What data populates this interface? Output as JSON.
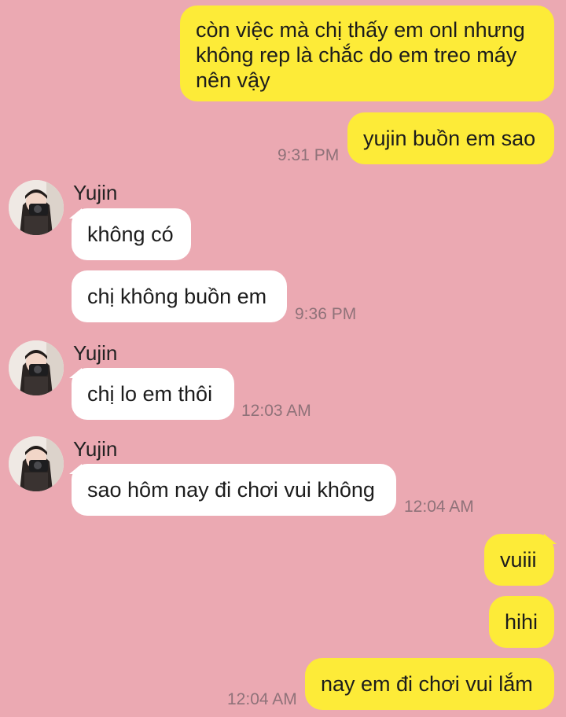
{
  "messages": {
    "m1": "còn việc mà chị thấy em onl nhưng không rep là chắc do em treo máy nên vậy",
    "m2": "yujin buồn em sao",
    "t2": "9:31 PM",
    "m3": "không có",
    "m4": "chị không buồn em",
    "t4": "9:36 PM",
    "m5": "chị lo em thôi",
    "t5": "12:03 AM",
    "m6": "sao hôm nay đi chơi vui không",
    "t6": "12:04 AM",
    "m7": "vuiii",
    "m8": "hihi",
    "m9": "nay em đi chơi vui lắm",
    "t9": "12:04 AM"
  },
  "contact": {
    "name": "Yujin"
  },
  "colors": {
    "background": "#eba9b2",
    "outgoing_bubble": "#fdeb38",
    "incoming_bubble": "#ffffff",
    "timestamp": "#8f7279"
  }
}
